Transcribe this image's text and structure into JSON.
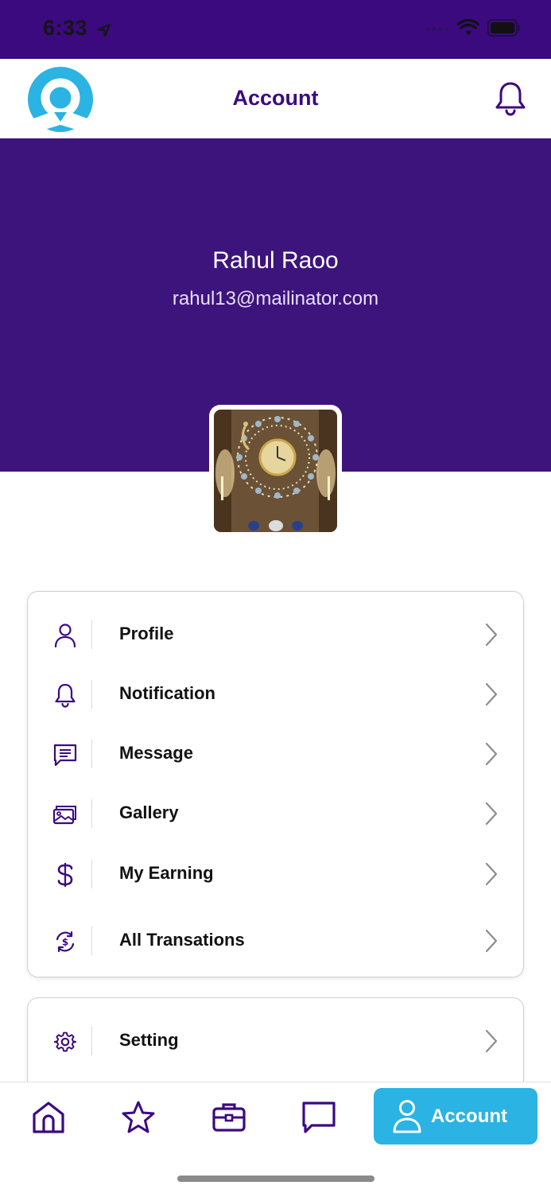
{
  "status_bar": {
    "time": "6:33"
  },
  "header": {
    "title": "Account"
  },
  "profile": {
    "name": "Rahul Raoo",
    "email": "rahul13@mailinator.com"
  },
  "menu": [
    {
      "label": "Profile",
      "icon": "user-icon"
    },
    {
      "label": "Notification",
      "icon": "bell-icon"
    },
    {
      "label": "Message",
      "icon": "message-icon"
    },
    {
      "label": "Gallery",
      "icon": "gallery-icon"
    },
    {
      "label": "My Earning",
      "icon": "dollar-icon"
    },
    {
      "label": "All Transations",
      "icon": "transactions-icon"
    }
  ],
  "settings_menu": [
    {
      "label": "Setting",
      "icon": "gear-icon"
    }
  ],
  "tabbar": {
    "items": [
      "home-icon",
      "star-icon",
      "briefcase-icon",
      "chat-icon"
    ],
    "active_label": "Account"
  },
  "colors": {
    "primary": "#3d147c",
    "accent": "#2ab3e3",
    "status_bar": "#3a0a7e"
  }
}
